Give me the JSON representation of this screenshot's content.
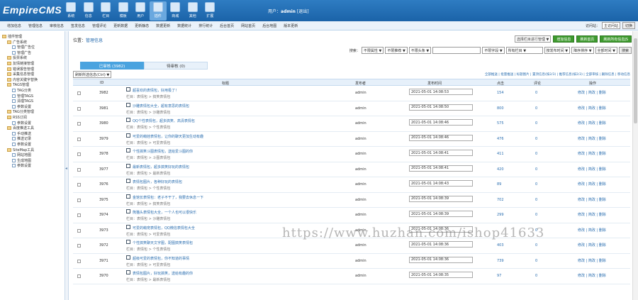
{
  "app": {
    "logo": "EmpireCMS"
  },
  "topnav": [
    {
      "label": "系统",
      "icon": "system-icon"
    },
    {
      "label": "信息",
      "icon": "info-icon"
    },
    {
      "label": "栏目",
      "icon": "column-icon"
    },
    {
      "label": "模板",
      "icon": "template-icon"
    },
    {
      "label": "用户",
      "icon": "user-icon"
    },
    {
      "label": "插件",
      "icon": "plugin-icon"
    },
    {
      "label": "商城",
      "icon": "shop-icon"
    },
    {
      "label": "其他",
      "icon": "other-icon"
    },
    {
      "label": "扩展",
      "icon": "extend-icon"
    }
  ],
  "user": {
    "label": "用户：",
    "name": "admin",
    "logout": "[退出]"
  },
  "subnav": [
    "增加信息",
    "管理信息",
    "审核信息",
    "签发信息",
    "管理评论",
    "更新数据",
    "更新静态",
    "数据更新",
    "数据统计",
    "排行统计",
    "后台首页",
    "网站首页",
    "后台地图",
    "版本更新"
  ],
  "subnav_right": {
    "label": "访问站：",
    "select": "主访问站",
    "button": "切换"
  },
  "sidebar": [
    {
      "text": "插件管理",
      "type": "box",
      "level": 0
    },
    {
      "text": "广告系统",
      "type": "box",
      "level": 1
    },
    {
      "text": "管理广告位",
      "type": "dot",
      "level": 2
    },
    {
      "text": "管理广告",
      "type": "dot",
      "level": 2
    },
    {
      "text": "投票系统",
      "type": "box",
      "level": 1
    },
    {
      "text": "友情链接管理",
      "type": "box",
      "level": 1
    },
    {
      "text": "错误报告管理",
      "type": "box",
      "level": 1
    },
    {
      "text": "采集信息管理",
      "type": "box",
      "level": 1
    },
    {
      "text": "内容关键字替换",
      "type": "box",
      "level": 1
    },
    {
      "text": "TAGS管理",
      "type": "box",
      "level": 1
    },
    {
      "text": "TAG分类",
      "type": "dot",
      "level": 2
    },
    {
      "text": "管理TAGS",
      "type": "dot",
      "level": 2
    },
    {
      "text": "清理TAGS",
      "type": "dot",
      "level": 2
    },
    {
      "text": "参数设置",
      "type": "dot",
      "level": 2
    },
    {
      "text": "TAG分类管理",
      "type": "box",
      "level": 1
    },
    {
      "text": "RSS订阅",
      "type": "box",
      "level": 1
    },
    {
      "text": "参数设置",
      "type": "dot",
      "level": 2
    },
    {
      "text": "百度推送工具",
      "type": "box",
      "level": 1
    },
    {
      "text": "手动推送",
      "type": "dot",
      "level": 2
    },
    {
      "text": "推送记录",
      "type": "dot",
      "level": 2
    },
    {
      "text": "参数设置",
      "type": "dot",
      "level": 2
    },
    {
      "text": "SiteMap工具",
      "type": "box",
      "level": 1
    },
    {
      "text": "网站地图",
      "type": "dot",
      "level": 2
    },
    {
      "text": "生成地图",
      "type": "dot",
      "level": 2
    },
    {
      "text": "参数设置",
      "type": "dot",
      "level": 2
    }
  ],
  "location": {
    "label": "位置：",
    "text": "管理信息"
  },
  "top_actions": {
    "select": "选择栏目进行管理 ▼",
    "buttons": [
      "增加信息",
      "刷新首页",
      "刷新所有信息JS"
    ]
  },
  "search": {
    "label": "搜索：",
    "selects": [
      "不限属性 ▼",
      "不限推荐 ▼",
      "不限头条 ▼"
    ],
    "input": "",
    "selects2": [
      "不限字段 ▼",
      "所有栏目 ▼",
      "按发布时间 ▼",
      "降序排序 ▼",
      "全部时间 ▼"
    ],
    "button": "搜索"
  },
  "tabs": [
    {
      "label": "已审核 (3982)",
      "active": true
    },
    {
      "label": "待审核 (0)",
      "active": false
    }
  ],
  "ops": {
    "select": "刷新所选信息(Ctrl) ▼",
    "links": "全部推送 | 批量推送 | 标题图片 | 置顶信息(按2/3) | 推荐信息(按2/3) | 全部审核 | 删除信息 | 移动信息"
  },
  "table": {
    "headers": [
      "ID",
      "标题",
      "发布者",
      "发布时间",
      "点击",
      "评论",
      "操作"
    ],
    "rows": [
      {
        "id": "3982",
        "title": "超喜欢的表情包，好用极了！",
        "cat": "栏目：表情包 > 搞笑表情包",
        "author": "admin",
        "date": "2021-05-01 14:08:53",
        "hits": "154",
        "comments": "0"
      },
      {
        "id": "3981",
        "title": "沙雕表情包大全，超有意思的表情包",
        "cat": "栏目：表情包 > 沙雕表情包",
        "author": "admin",
        "date": "2021-05-01 14:08:50",
        "hits": "800",
        "comments": "0"
      },
      {
        "id": "3980",
        "title": "QQ个性表情包，超多搞笑、高清表情包",
        "cat": "栏目：表情包 > 个性表情包",
        "author": "admin",
        "date": "2021-05-01 14:08:46",
        "hits": "575",
        "comments": "0"
      },
      {
        "id": "3979",
        "title": "可爱的萌娃表情包，让你的聊天更加生动有趣",
        "cat": "栏目：表情包 > 可爱表情包",
        "author": "admin",
        "date": "2021-05-01 14:08:46",
        "hits": "476",
        "comments": "0"
      },
      {
        "id": "3978",
        "title": "个性搞笑斗图表情包，送给爱斗图的你",
        "cat": "栏目：表情包 > 斗图表情包",
        "author": "admin",
        "date": "2021-05-01 14:08:41",
        "hits": "411",
        "comments": "0"
      },
      {
        "id": "3977",
        "title": "最新表情包，超多搞笑好玩的表情包",
        "cat": "栏目：表情包 > 最新表情包",
        "author": "admin",
        "date": "2021-05-01 14:08:41",
        "hits": "420",
        "comments": "0"
      },
      {
        "id": "3976",
        "title": "表情包图片，各种好玩的表情包",
        "cat": "栏目：表情包 > 个性表情包",
        "author": "admin",
        "date": "2021-05-01 14:08:43",
        "hits": "89",
        "comments": "0"
      },
      {
        "id": "3975",
        "title": "金馆长表情包：老子不干了，我要去休息一下",
        "cat": "栏目：表情包 > 搞笑表情包",
        "author": "admin",
        "date": "2021-05-01 14:08:39",
        "hits": "702",
        "comments": "0"
      },
      {
        "id": "3974",
        "title": "熊猫头表情包大全，一个人也可以很快乐",
        "cat": "栏目：表情包 > 沙雕表情包",
        "author": "admin",
        "date": "2021-05-01 14:08:39",
        "hits": "299",
        "comments": "0"
      },
      {
        "id": "3973",
        "title": "可爱的萌宠表情包，QQ微信表情包大全",
        "cat": "栏目：表情包 > 可爱表情包",
        "author": "admin",
        "date": "2021-05-01 14:08:36",
        "hits": "",
        "comments": "0"
      },
      {
        "id": "3972",
        "title": "个性搞笑聊天文字图，配图搞笑表情包",
        "cat": "栏目：表情包 > 个性表情包",
        "author": "admin",
        "date": "2021-05-01 14:08:36",
        "hits": "403",
        "comments": "0"
      },
      {
        "id": "3971",
        "title": "超级可爱的表情包，你不知道的事情",
        "cat": "栏目：表情包 > 可爱表情包",
        "author": "admin",
        "date": "2021-05-01 14:08:36",
        "hits": "739",
        "comments": "0"
      },
      {
        "id": "3970",
        "title": "表情包图片，好玩搞笑，送给有趣的你",
        "cat": "栏目：表情包 > 最新表情包",
        "author": "admin",
        "date": "2021-05-01 14:08:35",
        "hits": "97",
        "comments": "0"
      }
    ],
    "row_actions": "修改 | 简改 | 删除"
  },
  "watermark": "https://www.huzhan.com/ishop41633"
}
